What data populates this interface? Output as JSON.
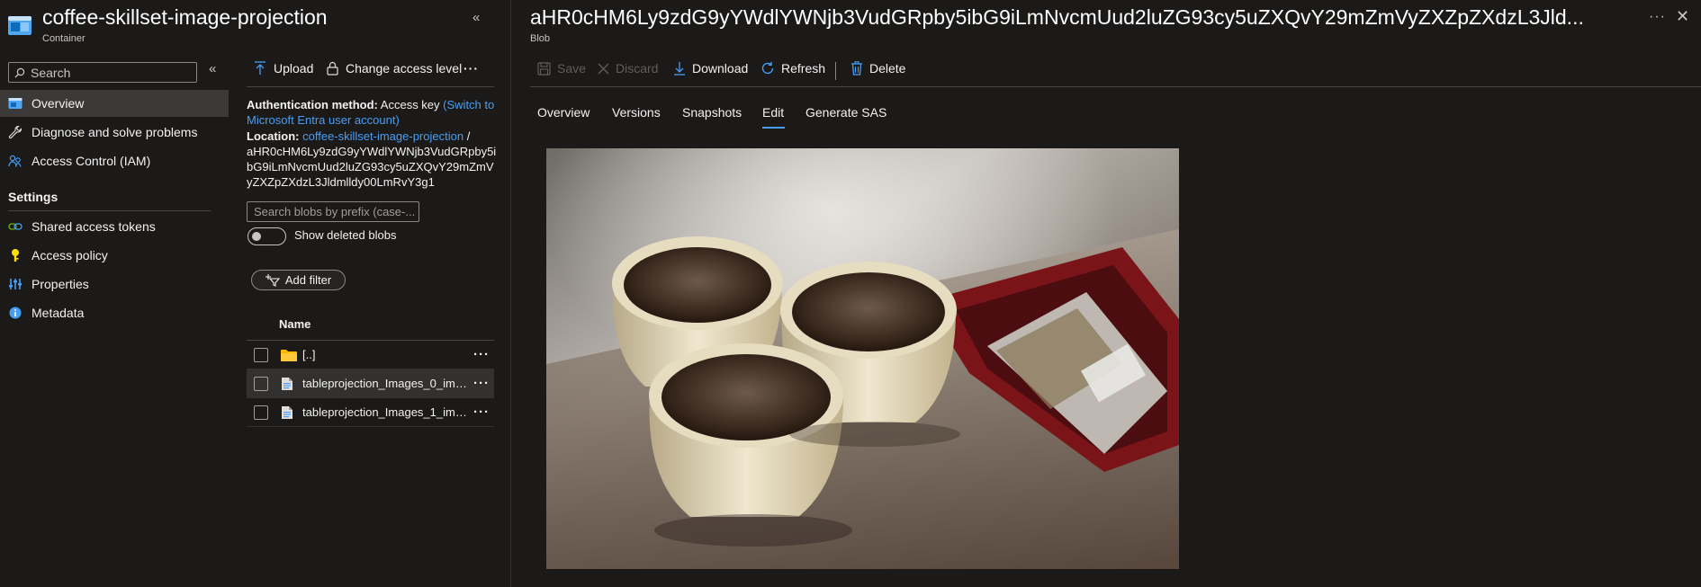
{
  "container": {
    "title": "coffee-skillset-image-projection",
    "subtitle": "Container"
  },
  "menu": {
    "search_placeholder": "Search",
    "items": [
      {
        "label": "Overview",
        "icon": "overview-icon"
      },
      {
        "label": "Diagnose and solve problems",
        "icon": "wrench-icon"
      },
      {
        "label": "Access Control (IAM)",
        "icon": "people-icon"
      }
    ],
    "settings_heading": "Settings",
    "settings_items": [
      {
        "label": "Shared access tokens",
        "icon": "link-icon"
      },
      {
        "label": "Access policy",
        "icon": "key-icon"
      },
      {
        "label": "Properties",
        "icon": "sliders-icon"
      },
      {
        "label": "Metadata",
        "icon": "info-icon"
      }
    ]
  },
  "container_toolbar": {
    "upload": "Upload",
    "change_access": "Change access level",
    "more": "···"
  },
  "auth": {
    "method_label": "Authentication method:",
    "method_value": "Access key",
    "switch_link": "(Switch to Microsoft Entra user account)",
    "location_label": "Location:",
    "location_link": "coffee-skillset-image-projection",
    "location_sep": "/",
    "location_path": "aHR0cHM6Ly9zdG9yYWdlYWNjb3VudGRpby5ibG9iLmNvcmUud2luZG93cy5uZXQvY29mZmVyZXZpZXdzL3Jldmlldy00LmRvY3g1"
  },
  "blob_search_placeholder": "Search blobs by prefix (case-...",
  "show_deleted_label": "Show deleted blobs",
  "add_filter_label": "Add filter",
  "list": {
    "column_name": "Name",
    "rows": [
      {
        "name": "[..]",
        "type": "folder"
      },
      {
        "name": "tableprojection_Images_0_img...",
        "type": "file"
      },
      {
        "name": "tableprojection_Images_1_img...",
        "type": "file"
      }
    ],
    "row_more": "···"
  },
  "blob": {
    "title": "aHR0cHM6Ly9zdG9yYWdlYWNjb3VudGRpby5ibG9iLmNvcmUud2luZG93cy5uZXQvY29mZmVyZXZpZXdzL3Jld...",
    "subtitle": "Blob",
    "more": "···",
    "close": "✕"
  },
  "blob_toolbar": {
    "save": "Save",
    "discard": "Discard",
    "download": "Download",
    "refresh": "Refresh",
    "delete": "Delete"
  },
  "tabs": [
    {
      "label": "Overview",
      "active": false
    },
    {
      "label": "Versions",
      "active": false
    },
    {
      "label": "Snapshots",
      "active": false
    },
    {
      "label": "Edit",
      "active": true
    },
    {
      "label": "Generate SAS",
      "active": false
    }
  ],
  "colors": {
    "background": "#1b1a19",
    "accent": "#479ef5",
    "selected_row": "#3b3a39"
  }
}
